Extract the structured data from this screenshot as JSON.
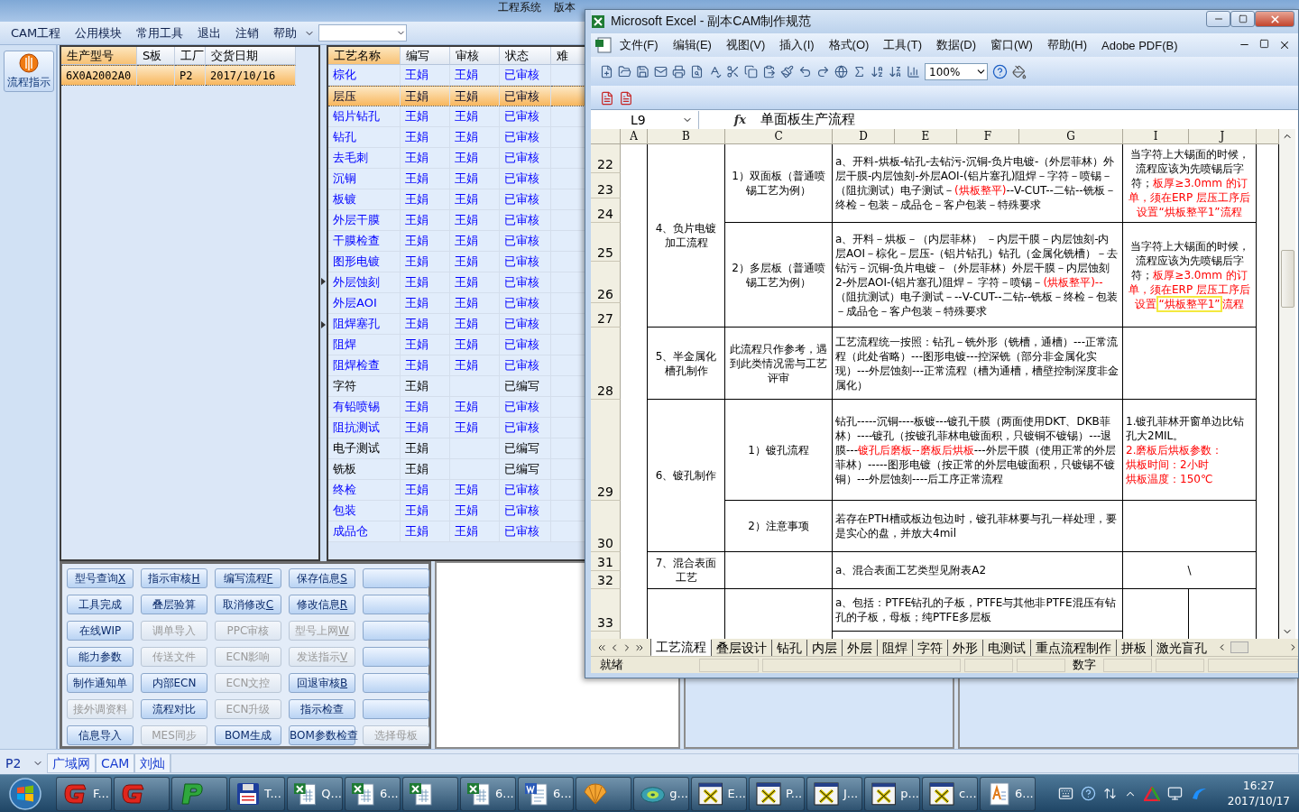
{
  "app": {
    "title": "工程系统",
    "version": "版本"
  },
  "menu": [
    {
      "label": "CAM工程"
    },
    {
      "label": "公用模块"
    },
    {
      "label": "常用工具"
    },
    {
      "label": "退出"
    },
    {
      "label": "注销"
    },
    {
      "label": "帮助"
    }
  ],
  "sidebar": {
    "button": "流程指示"
  },
  "orders": {
    "columns": [
      {
        "label": "生产型号",
        "active": true
      },
      {
        "label": "S板",
        "active": false
      },
      {
        "label": "工厂",
        "active": false
      },
      {
        "label": "交货日期",
        "active": false
      }
    ],
    "rows": [
      {
        "model": "6X0A2002A0",
        "factory": "P2",
        "date": "2017/10/16",
        "selected": true
      }
    ]
  },
  "process": {
    "columns": [
      {
        "label": "工艺名称",
        "active": true
      },
      {
        "label": "编写",
        "active": false
      },
      {
        "label": "审核",
        "active": false
      },
      {
        "label": "状态",
        "active": false
      },
      {
        "label": "难",
        "active": false
      }
    ],
    "rows": [
      {
        "name": "棕化",
        "writer": "王娟",
        "reviewer": "王娟",
        "status": "已审核",
        "reviewed": true,
        "selected": false
      },
      {
        "name": "层压",
        "writer": "王娟",
        "reviewer": "王娟",
        "status": "已审核",
        "reviewed": true,
        "selected": true
      },
      {
        "name": "铝片钻孔",
        "writer": "王娟",
        "reviewer": "王娟",
        "status": "已审核",
        "reviewed": true,
        "selected": false
      },
      {
        "name": "钻孔",
        "writer": "王娟",
        "reviewer": "王娟",
        "status": "已审核",
        "reviewed": true,
        "selected": false
      },
      {
        "name": "去毛刺",
        "writer": "王娟",
        "reviewer": "王娟",
        "status": "已审核",
        "reviewed": true,
        "selected": false
      },
      {
        "name": "沉铜",
        "writer": "王娟",
        "reviewer": "王娟",
        "status": "已审核",
        "reviewed": true,
        "selected": false
      },
      {
        "name": "板镀",
        "writer": "王娟",
        "reviewer": "王娟",
        "status": "已审核",
        "reviewed": true,
        "selected": false
      },
      {
        "name": "外层干膜",
        "writer": "王娟",
        "reviewer": "王娟",
        "status": "已审核",
        "reviewed": true,
        "selected": false
      },
      {
        "name": "干膜检查",
        "writer": "王娟",
        "reviewer": "王娟",
        "status": "已审核",
        "reviewed": true,
        "selected": false
      },
      {
        "name": "图形电镀",
        "writer": "王娟",
        "reviewer": "王娟",
        "status": "已审核",
        "reviewed": true,
        "selected": false
      },
      {
        "name": "外层蚀刻",
        "writer": "王娟",
        "reviewer": "王娟",
        "status": "已审核",
        "reviewed": true,
        "selected": false
      },
      {
        "name": "外层AOI",
        "writer": "王娟",
        "reviewer": "王娟",
        "status": "已审核",
        "reviewed": true,
        "selected": false
      },
      {
        "name": "阻焊塞孔",
        "writer": "王娟",
        "reviewer": "王娟",
        "status": "已审核",
        "reviewed": true,
        "selected": false
      },
      {
        "name": "阻焊",
        "writer": "王娟",
        "reviewer": "王娟",
        "status": "已审核",
        "reviewed": true,
        "selected": false
      },
      {
        "name": "阻焊检查",
        "writer": "王娟",
        "reviewer": "王娟",
        "status": "已审核",
        "reviewed": true,
        "selected": false
      },
      {
        "name": "字符",
        "writer": "王娟",
        "status": "已编写",
        "reviewed": false,
        "selected": false
      },
      {
        "name": "有铅喷锡",
        "writer": "王娟",
        "reviewer": "王娟",
        "status": "已审核",
        "reviewed": true,
        "selected": false
      },
      {
        "name": "阻抗测试",
        "writer": "王娟",
        "reviewer": "王娟",
        "status": "已审核",
        "reviewed": true,
        "selected": false
      },
      {
        "name": "电子测试",
        "writer": "王娟",
        "status": "已编写",
        "reviewed": false,
        "selected": false
      },
      {
        "name": "铣板",
        "writer": "王娟",
        "status": "已编写",
        "reviewed": false,
        "selected": false
      },
      {
        "name": "终检",
        "writer": "王娟",
        "reviewer": "王娟",
        "status": "已审核",
        "reviewed": true,
        "selected": false
      },
      {
        "name": "包装",
        "writer": "王娟",
        "reviewer": "王娟",
        "status": "已审核",
        "reviewed": true,
        "selected": false
      },
      {
        "name": "成品仓",
        "writer": "王娟",
        "reviewer": "王娟",
        "status": "已审核",
        "reviewed": true,
        "selected": false
      }
    ]
  },
  "buttons": [
    {
      "kind": "label",
      "label": "型号查询",
      "hotkey": "X",
      "disabled": false
    },
    {
      "kind": "label",
      "label": "指示审核",
      "hotkey": "H",
      "disabled": false
    },
    {
      "kind": "label",
      "label": "编写流程",
      "hotkey": "F",
      "disabled": false
    },
    {
      "kind": "label",
      "label": "保存信息",
      "hotkey": "S",
      "disabled": false
    },
    {
      "kind": "blank"
    },
    {
      "kind": "label",
      "label": "工具完成",
      "disabled": false
    },
    {
      "kind": "label",
      "label": "叠层验算",
      "disabled": false
    },
    {
      "kind": "label",
      "label": "取消修改",
      "hotkey": "C",
      "disabled": false
    },
    {
      "kind": "label",
      "label": "修改信息",
      "hotkey": "R",
      "disabled": false
    },
    {
      "kind": "blank"
    },
    {
      "kind": "label",
      "label": "在线WIP",
      "disabled": false
    },
    {
      "kind": "label",
      "label": "调单导入",
      "disabled": true
    },
    {
      "kind": "label",
      "label": "PPC审核",
      "disabled": true
    },
    {
      "kind": "label",
      "label": "型号上网",
      "hotkey": "W",
      "disabled": true
    },
    {
      "kind": "blank"
    },
    {
      "kind": "label",
      "label": "能力参数",
      "disabled": false
    },
    {
      "kind": "label",
      "label": "传送文件",
      "disabled": true
    },
    {
      "kind": "label",
      "label": "ECN影响",
      "disabled": true
    },
    {
      "kind": "label",
      "label": "发送指示",
      "hotkey": "V",
      "disabled": true
    },
    {
      "kind": "blank"
    },
    {
      "kind": "label",
      "label": "制作通知单",
      "disabled": false
    },
    {
      "kind": "label",
      "label": "内部ECN",
      "disabled": false
    },
    {
      "kind": "label",
      "label": "ECN文控",
      "disabled": true
    },
    {
      "kind": "label",
      "label": "回退审核",
      "hotkey": "B",
      "disabled": false
    },
    {
      "kind": "blank"
    },
    {
      "kind": "label",
      "label": "接外调资料",
      "disabled": true
    },
    {
      "kind": "label",
      "label": "流程对比",
      "disabled": false
    },
    {
      "kind": "label",
      "label": "ECN升级",
      "disabled": true
    },
    {
      "kind": "label",
      "label": "指示检查",
      "disabled": false
    },
    {
      "kind": "blank"
    },
    {
      "kind": "label",
      "label": "信息导入",
      "disabled": false
    },
    {
      "kind": "label",
      "label": "MES同步",
      "disabled": true
    },
    {
      "kind": "label",
      "label": "BOM生成",
      "disabled": false
    },
    {
      "kind": "label",
      "label": "BOM参数检查",
      "disabled": false
    },
    {
      "kind": "label",
      "label": "选择母板",
      "disabled": true
    }
  ],
  "status_bar": {
    "field": "P2",
    "cells": [
      "广域网",
      "CAM",
      "刘灿"
    ]
  },
  "excel": {
    "title": "Microsoft Excel - 副本CAM制作规范",
    "menu": [
      "文件(F)",
      "编辑(E)",
      "视图(V)",
      "插入(I)",
      "格式(O)",
      "工具(T)",
      "数据(D)",
      "窗口(W)",
      "帮助(H)",
      "Adobe PDF(B)"
    ],
    "zoom": "100%",
    "name_box": "L9",
    "function_label": "fx",
    "formula": "单面板生产流程",
    "columns": [
      "A",
      "B",
      "C",
      "D",
      "E",
      "F",
      "G",
      "I",
      "J"
    ],
    "row_numbers": [
      "22",
      "23",
      "24",
      "25",
      "26",
      "27",
      "28",
      "29",
      "30",
      "31",
      "32",
      "33"
    ],
    "cells": [
      {
        "paragraphs": [
          [
            {
              "text": "4、负片电镀加工流程",
              "highlight": false,
              "boxed": false
            }
          ]
        ]
      },
      {
        "paragraphs": [
          [
            {
              "text": "1）双面板（普通喷锡工艺为例）",
              "highlight": false,
              "boxed": false
            }
          ]
        ]
      },
      {
        "paragraphs": [
          [
            {
              "text": "a、开料-烘板-钻孔-去钻污-沉铜-负片电镀-（外层菲林）外层干膜-内层蚀刻-外层AOI-(铝片塞孔)阻焊－字符－喷锡－（阻抗测试）电子测试－",
              "highlight": false,
              "boxed": false
            },
            {
              "text": "(烘板整平)",
              "highlight": true,
              "boxed": false
            },
            {
              "text": "--V-CUT--二钻--铣板－终检－包装－成品仓－客户包装－特殊要求",
              "highlight": false,
              "boxed": false
            }
          ]
        ]
      },
      {
        "paragraphs": [
          [
            {
              "text": "当字符上大锡面的时候，流程应该为先喷锡后字符；",
              "highlight": false,
              "boxed": false
            },
            {
              "text": "板厚≥3.0mm 的订单，须在ERP 层压工序后设置“烘板整平1”流程",
              "highlight": true,
              "boxed": false
            }
          ]
        ]
      },
      {
        "paragraphs": [
          [
            {
              "text": "2）多层板（普通喷锡工艺为例）",
              "highlight": false,
              "boxed": false
            }
          ]
        ]
      },
      {
        "paragraphs": [
          [
            {
              "text": "a、开料－烘板－（内层菲林） －内层干膜－内层蚀刻-内层AOI－棕化－层压-（铝片钻孔）钻孔（金属化铣槽）－去钻污－沉铜-负片电镀－（外层菲林）外层干膜－内层蚀刻2-外层AOI-(铝片塞孔)阻焊－ 字符－喷锡－",
              "highlight": false,
              "boxed": false
            },
            {
              "text": "(烘板整平)--",
              "highlight": true,
              "boxed": false
            },
            {
              "text": "（阻抗测试）电子测试－--V-CUT--二钻--铣板－终检－包装－成品仓－客户包装－特殊要求",
              "highlight": false,
              "boxed": false
            }
          ]
        ]
      },
      {
        "paragraphs": [
          [
            {
              "text": "当字符上大锡面的时候，流程应该为先喷锡后字符；",
              "highlight": false,
              "boxed": false
            },
            {
              "text": "板厚≥3.0mm 的订单，须在ERP 层压工序后设置",
              "highlight": true,
              "boxed": false
            },
            {
              "text": "“烘板整平1”",
              "highlight": true,
              "boxed": true
            },
            {
              "text": "流程",
              "highlight": true,
              "boxed": false
            }
          ]
        ]
      },
      {
        "paragraphs": [
          [
            {
              "text": "5、半金属化槽孔制作",
              "highlight": false,
              "boxed": false
            }
          ]
        ]
      },
      {
        "paragraphs": [
          [
            {
              "text": "此流程只作参考，遇到此类情况需与工艺评审",
              "highlight": false,
              "boxed": false
            }
          ]
        ]
      },
      {
        "paragraphs": [
          [
            {
              "text": "工艺流程统一按照：钻孔－铣外形（铣槽，通槽）---正常流程（此处省略）---图形电镀---控深铣（部分非金属化实现）---外层蚀刻---正常流程（槽为通槽，槽壁控制深度非金属化）",
              "highlight": false,
              "boxed": false
            }
          ]
        ]
      },
      {
        "paragraphs": [
          [
            {
              "text": "6、镀孔制作",
              "highlight": false,
              "boxed": false
            }
          ]
        ]
      },
      {
        "paragraphs": [
          [
            {
              "text": "1）镀孔流程",
              "highlight": false,
              "boxed": false
            }
          ]
        ]
      },
      {
        "paragraphs": [
          [
            {
              "text": "钻孔-----沉铜----板镀---镀孔干膜（两面使用DKT、DKB菲林）----镀孔（按镀孔菲林电镀面积，只镀铜不镀锡）---退膜---",
              "highlight": false,
              "boxed": false
            },
            {
              "text": "镀孔后磨板--磨板后烘板",
              "highlight": true,
              "boxed": false
            },
            {
              "text": "---外层干膜（使用正常的外层菲林）-----图形电镀（按正常的外层电镀面积，只镀锡不镀铜）---外层蚀刻----后工序正常流程",
              "highlight": false,
              "boxed": false
            }
          ]
        ]
      },
      {
        "paragraphs": [
          [
            {
              "text": "1.镀孔菲林开窗单边比钻孔大2MIL。",
              "highlight": false,
              "boxed": false
            }
          ],
          [
            {
              "text": "2.磨板后烘板参数：",
              "highlight": true,
              "boxed": false
            }
          ],
          [
            {
              "text": "烘板时间：2小时",
              "highlight": true,
              "boxed": false
            }
          ],
          [
            {
              "text": "烘板温度：150℃",
              "highlight": true,
              "boxed": false
            }
          ]
        ]
      },
      {
        "paragraphs": [
          [
            {
              "text": "2）注意事项",
              "highlight": false,
              "boxed": false
            }
          ]
        ]
      },
      {
        "paragraphs": [
          [
            {
              "text": "若存在PTH槽或板边包边时，镀孔菲林要与孔一样处理，要是实心的盘，并放大4mil",
              "highlight": false,
              "boxed": false
            }
          ]
        ]
      },
      {
        "paragraphs": [
          [
            {
              "text": "7、混合表面工艺",
              "highlight": false,
              "boxed": false
            }
          ]
        ]
      },
      {
        "paragraphs": [
          [
            {
              "text": "a、混合表面工艺类型见附表A2",
              "highlight": false,
              "boxed": false
            }
          ]
        ]
      },
      {
        "paragraphs": [
          [
            {
              "text": "\\",
              "highlight": false,
              "boxed": false
            }
          ]
        ]
      },
      {
        "paragraphs": [
          [
            {
              "text": "a、包括：PTFE钻孔的子板，PTFE与其他非PTFE混压有钻孔的子板，母板；纯PTFE多层板",
              "highlight": false,
              "boxed": false
            }
          ]
        ]
      }
    ],
    "sheet_tabs": [
      {
        "label": "工艺流程",
        "selected": true
      },
      {
        "label": "叠层设计",
        "selected": false
      },
      {
        "label": "钻孔",
        "selected": false
      },
      {
        "label": "内层",
        "selected": false
      },
      {
        "label": "外层",
        "selected": false
      },
      {
        "label": "阻焊",
        "selected": false
      },
      {
        "label": "字符",
        "selected": false
      },
      {
        "label": "外形",
        "selected": false
      },
      {
        "label": "电测试",
        "selected": false
      },
      {
        "label": "重点流程制作",
        "selected": false
      },
      {
        "label": "拼板",
        "selected": false
      },
      {
        "label": "激光盲孔",
        "selected": false
      }
    ],
    "status": {
      "ready": "就绪",
      "mode": "数字"
    }
  },
  "taskbar": {
    "items": [
      {
        "kind": "gapp",
        "label": "F..."
      },
      {
        "kind": "gapp"
      },
      {
        "kind": "papp"
      },
      {
        "kind": "floppy",
        "label": "T..."
      },
      {
        "kind": "excel",
        "label": "Q..."
      },
      {
        "kind": "excel",
        "label": "6..."
      },
      {
        "kind": "excel"
      },
      {
        "kind": "excel",
        "label": "6..."
      },
      {
        "kind": "word",
        "label": "6..."
      },
      {
        "kind": "shell"
      },
      {
        "kind": "disc",
        "label": "g..."
      },
      {
        "kind": "xapp",
        "label": "E..."
      },
      {
        "kind": "xapp",
        "label": "P..."
      },
      {
        "kind": "xapp",
        "label": "J..."
      },
      {
        "kind": "xapp",
        "label": "p..."
      },
      {
        "kind": "xapp",
        "label": "c..."
      },
      {
        "kind": "font",
        "label": "6..."
      }
    ],
    "time": "16:27",
    "date": "2017/10/17"
  }
}
